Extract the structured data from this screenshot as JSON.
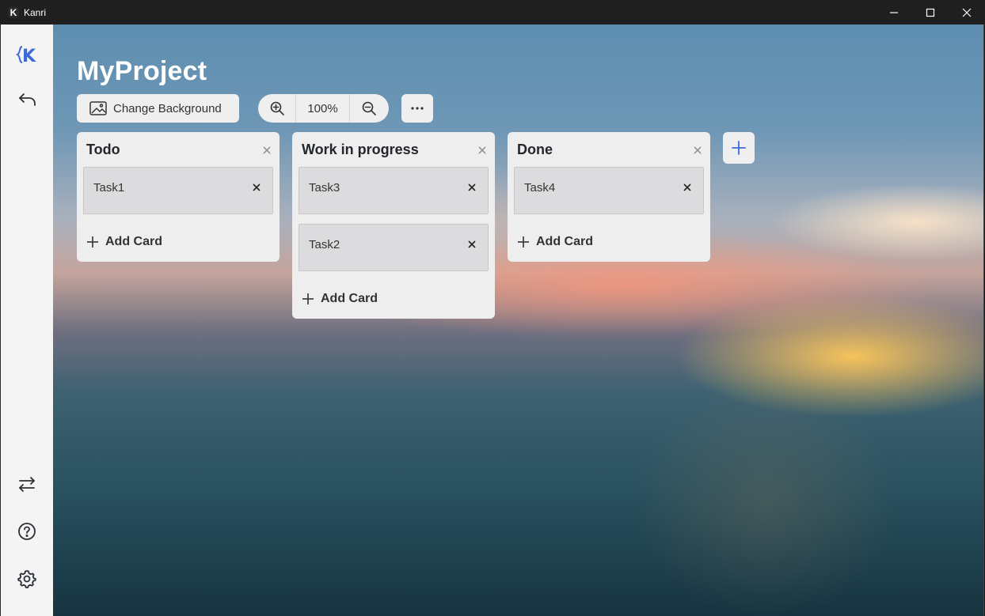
{
  "window": {
    "app_icon_letter": "K",
    "title": "Kanri"
  },
  "sidebar": {
    "logo_label": "K"
  },
  "board": {
    "title": "MyProject",
    "change_background_label": "Change Background",
    "zoom_level": "100%"
  },
  "columns": [
    {
      "title": "Todo",
      "cards": [
        {
          "title": "Task1"
        }
      ],
      "add_card_label": "Add Card"
    },
    {
      "title": "Work in progress",
      "cards": [
        {
          "title": "Task3"
        },
        {
          "title": "Task2"
        }
      ],
      "add_card_label": "Add Card"
    },
    {
      "title": "Done",
      "cards": [
        {
          "title": "Task4"
        }
      ],
      "add_card_label": "Add Card"
    }
  ],
  "colors": {
    "accent": "#3b6ad8",
    "column_bg": "#eeeeef",
    "card_bg": "#dcdcde",
    "titlebar": "#1f1f1f"
  }
}
